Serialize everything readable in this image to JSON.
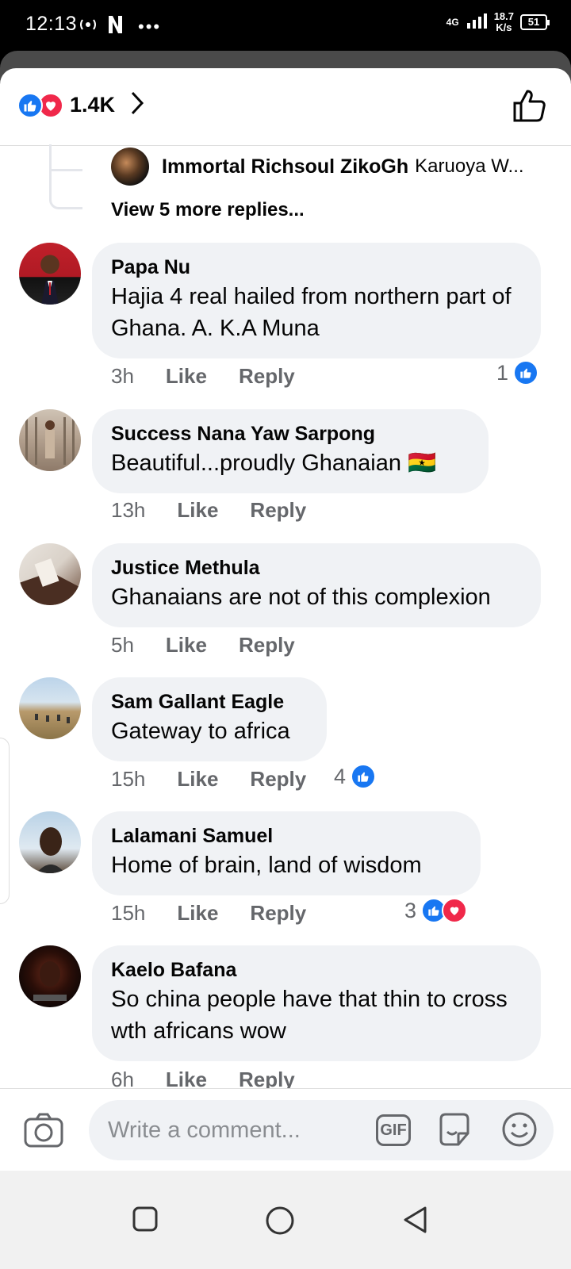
{
  "status_bar": {
    "time": "12:13",
    "network": "4G",
    "speed_value": "18.7",
    "speed_unit": "K/s",
    "battery": "51"
  },
  "header": {
    "reaction_count": "1.4K",
    "reaction_icons": [
      "like-icon",
      "love-icon"
    ]
  },
  "thread_reply": {
    "name": "Immortal Richsoul ZikoGh",
    "preview": "Karuoya W...",
    "view_more": "View 5 more replies..."
  },
  "comments": [
    {
      "name": "Papa Nu",
      "text": "Hajia 4 real hailed from northern part of Ghana. A. K.A Muna",
      "time": "3h",
      "like": "Like",
      "reply": "Reply",
      "reaction_count": "1",
      "reactions": [
        "like"
      ]
    },
    {
      "name": "Success Nana Yaw Sarpong",
      "text": "Beautiful...proudly Ghanaian 🇬🇭",
      "time": "13h",
      "like": "Like",
      "reply": "Reply"
    },
    {
      "name": "Justice Methula",
      "text": "Ghanaians are not of this complexion",
      "time": "5h",
      "like": "Like",
      "reply": "Reply"
    },
    {
      "name": "Sam Gallant Eagle",
      "text": "Gateway to africa",
      "time": "15h",
      "like": "Like",
      "reply": "Reply",
      "reaction_count": "4",
      "reactions": [
        "like"
      ]
    },
    {
      "name": "Lalamani Samuel",
      "text": "Home of brain, land of wisdom",
      "time": "15h",
      "like": "Like",
      "reply": "Reply",
      "reaction_count": "3",
      "reactions": [
        "like",
        "love"
      ]
    },
    {
      "name": "Kaelo Bafana",
      "text": "So china people have that thin to cross wth africans wow",
      "time": "6h",
      "like": "Like",
      "reply": "Reply"
    }
  ],
  "composer": {
    "placeholder": "Write a comment...",
    "gif_label": "GIF"
  },
  "colors": {
    "accent": "#1877f2",
    "love": "#f0284a",
    "bubble": "#f0f2f5",
    "meta_text": "#65676b"
  }
}
